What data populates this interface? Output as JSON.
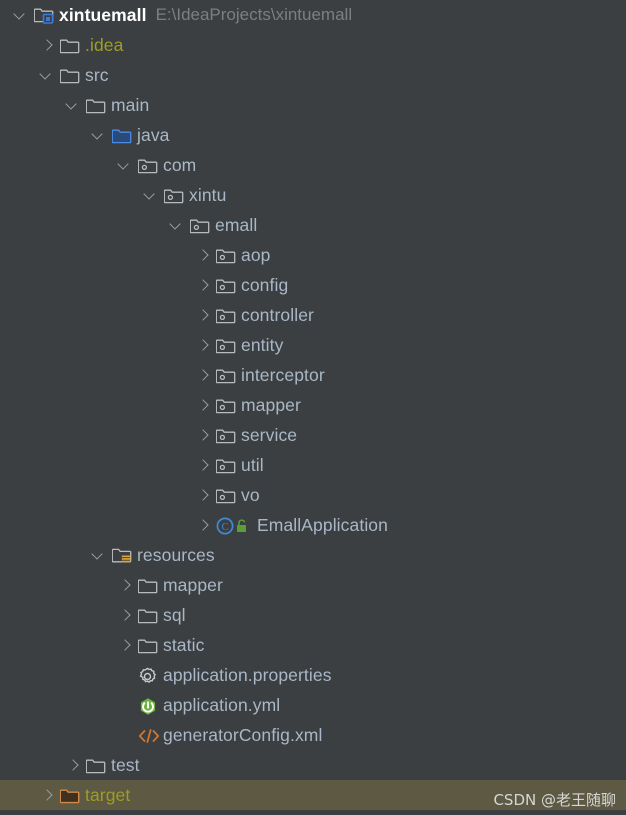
{
  "window": {
    "background_color": "#3c3f41",
    "selected_row_color": "#5d5942",
    "default_text_color": "#a9b7c6"
  },
  "watermark": {
    "text": "CSDN @老王随聊"
  },
  "project_tree": {
    "root_label": "xintuemall",
    "root_path": "E:\\IdeaProjects\\xintuemall",
    "rows": [
      {
        "label": "xintuemall",
        "path": "E:\\IdeaProjects\\xintuemall",
        "icon": "module-folder-icon",
        "depth": 0,
        "arrow": "open",
        "style": "root"
      },
      {
        "label": ".idea",
        "path": "",
        "icon": "folder-icon",
        "depth": 1,
        "arrow": "closed",
        "style": "excluded"
      },
      {
        "label": "src",
        "path": "",
        "icon": "folder-icon",
        "depth": 1,
        "arrow": "open",
        "style": "normal"
      },
      {
        "label": "main",
        "path": "",
        "icon": "folder-icon",
        "depth": 2,
        "arrow": "open",
        "style": "normal"
      },
      {
        "label": "java",
        "path": "",
        "icon": "source-root-folder-icon",
        "depth": 3,
        "arrow": "open",
        "style": "normal"
      },
      {
        "label": "com",
        "path": "",
        "icon": "package-icon",
        "depth": 4,
        "arrow": "open",
        "style": "normal"
      },
      {
        "label": "xintu",
        "path": "",
        "icon": "package-icon",
        "depth": 5,
        "arrow": "open",
        "style": "normal"
      },
      {
        "label": "emall",
        "path": "",
        "icon": "package-icon",
        "depth": 6,
        "arrow": "open",
        "style": "normal"
      },
      {
        "label": "aop",
        "path": "",
        "icon": "package-icon",
        "depth": 7,
        "arrow": "closed",
        "style": "normal"
      },
      {
        "label": "config",
        "path": "",
        "icon": "package-icon",
        "depth": 7,
        "arrow": "closed",
        "style": "normal"
      },
      {
        "label": "controller",
        "path": "",
        "icon": "package-icon",
        "depth": 7,
        "arrow": "closed",
        "style": "normal"
      },
      {
        "label": "entity",
        "path": "",
        "icon": "package-icon",
        "depth": 7,
        "arrow": "closed",
        "style": "normal"
      },
      {
        "label": "interceptor",
        "path": "",
        "icon": "package-icon",
        "depth": 7,
        "arrow": "closed",
        "style": "normal"
      },
      {
        "label": "mapper",
        "path": "",
        "icon": "package-icon",
        "depth": 7,
        "arrow": "closed",
        "style": "normal"
      },
      {
        "label": "service",
        "path": "",
        "icon": "package-icon",
        "depth": 7,
        "arrow": "closed",
        "style": "normal"
      },
      {
        "label": "util",
        "path": "",
        "icon": "package-icon",
        "depth": 7,
        "arrow": "closed",
        "style": "normal"
      },
      {
        "label": "vo",
        "path": "",
        "icon": "package-icon",
        "depth": 7,
        "arrow": "closed",
        "style": "normal"
      },
      {
        "label": "EmallApplication",
        "path": "",
        "icon": "java-class-public-icon",
        "depth": 7,
        "arrow": "closed",
        "style": "normal"
      },
      {
        "label": "resources",
        "path": "",
        "icon": "resources-root-folder-icon",
        "depth": 3,
        "arrow": "open",
        "style": "normal"
      },
      {
        "label": "mapper",
        "path": "",
        "icon": "folder-icon",
        "depth": 4,
        "arrow": "closed",
        "style": "normal"
      },
      {
        "label": "sql",
        "path": "",
        "icon": "folder-icon",
        "depth": 4,
        "arrow": "closed",
        "style": "normal"
      },
      {
        "label": "static",
        "path": "",
        "icon": "folder-icon",
        "depth": 4,
        "arrow": "closed",
        "style": "normal"
      },
      {
        "label": "application.properties",
        "path": "",
        "icon": "properties-file-icon",
        "depth": 4,
        "arrow": "none",
        "style": "normal"
      },
      {
        "label": "application.yml",
        "path": "",
        "icon": "spring-yaml-file-icon",
        "depth": 4,
        "arrow": "none",
        "style": "normal"
      },
      {
        "label": "generatorConfig.xml",
        "path": "",
        "icon": "xml-file-icon",
        "depth": 4,
        "arrow": "none",
        "style": "normal"
      },
      {
        "label": "test",
        "path": "",
        "icon": "folder-icon",
        "depth": 2,
        "arrow": "closed",
        "style": "normal"
      },
      {
        "label": "target",
        "path": "",
        "icon": "excluded-folder-icon",
        "depth": 1,
        "arrow": "closed",
        "style": "target",
        "selected": true
      }
    ]
  }
}
